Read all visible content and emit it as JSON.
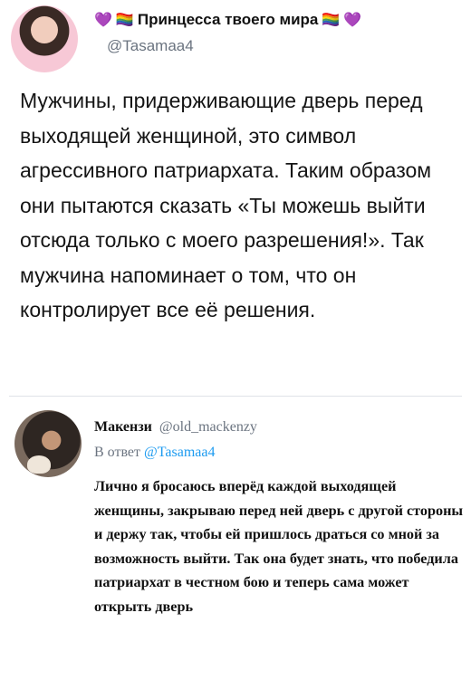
{
  "tweet": {
    "author_name": "Принцесса твоего мира",
    "handle": "@Tasamaa4",
    "text": "Мужчины, придерживающие дверь перед выходящей женщиной, это символ агрессивного патриархата. Таким образом они пытаются сказать «Ты можешь выйти отсюда только с моего разрешения!». Так мужчина напоминает о том, что он контролирует все её решения.",
    "emoji_left": [
      "💜",
      "🏳️‍🌈"
    ],
    "emoji_right": [
      "🏳️‍🌈",
      "💜"
    ]
  },
  "reply": {
    "author_name": "Макензи",
    "handle": "@old_mackenzy",
    "reply_to_prefix": "В ответ",
    "reply_to_handle": "@Tasamaa4",
    "text": "Лично я бросаюсь вперёд каждой выходящей женщины, закрываю перед ней дверь с другой стороны и держу так, чтобы ей пришлось драться со мной за возможность выйти. Так она будет знать, что победила патриархат в честном бою и теперь сама может открыть дверь"
  },
  "colors": {
    "handle_gray": "#6b7480",
    "link_blue": "#1d9bf0",
    "divider": "#dfe3e8"
  }
}
